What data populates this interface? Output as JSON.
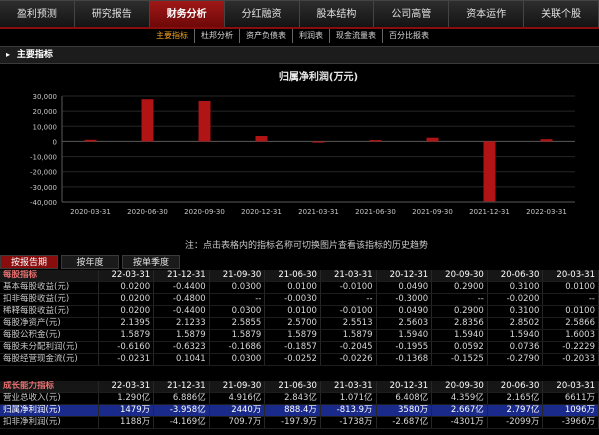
{
  "tabs": [
    {
      "label": "盈利预测",
      "active": false
    },
    {
      "label": "研究报告",
      "active": false
    },
    {
      "label": "财务分析",
      "active": true
    },
    {
      "label": "分红融资",
      "active": false
    },
    {
      "label": "股本结构",
      "active": false
    },
    {
      "label": "公司高管",
      "active": false
    },
    {
      "label": "资本运作",
      "active": false
    },
    {
      "label": "关联个股",
      "active": false
    }
  ],
  "subtabs": [
    {
      "label": "主要指标",
      "active": true
    },
    {
      "label": "杜邦分析",
      "active": false
    },
    {
      "label": "资产负债表",
      "active": false
    },
    {
      "label": "利润表",
      "active": false
    },
    {
      "label": "现金流量表",
      "active": false
    },
    {
      "label": "百分比报表",
      "active": false
    }
  ],
  "section": {
    "arrow": "▸",
    "title": "主要指标"
  },
  "note": "注：点击表格内的指标名称可切换图片查看该指标的历史趋势",
  "period_tabs": [
    {
      "label": "按报告期",
      "active": true
    },
    {
      "label": "按年度",
      "active": false
    },
    {
      "label": "按单季度",
      "active": false
    }
  ],
  "colors": {
    "accent": "#8a0d0d",
    "bar": "#b01414",
    "selected_row": "#1a2a8a",
    "active_subtab": "#f0a020"
  },
  "chart_data": {
    "type": "bar",
    "title": "归属净利润(万元)",
    "ylim": [
      -40000,
      30000
    ],
    "yticks": [
      30000,
      20000,
      10000,
      0,
      -10000,
      -20000,
      -30000,
      -40000
    ],
    "ytick_labels": [
      "30,000",
      "20,000",
      "10,000",
      "0",
      "-10,000",
      "-20,000",
      "-30,000",
      "-40,000"
    ],
    "x_tick_labels": [
      "2020-03-31",
      "2020-06-30",
      "2020-09-30",
      "2020-12-31",
      "2021-03-31",
      "2021-06-30",
      "2021-09-30",
      "2021-12-31",
      "2022-03-31"
    ],
    "categories": [
      "2020-03-31",
      "2020-06-30",
      "2020-09-30",
      "2020-12-31",
      "2021-03-31",
      "2021-06-30",
      "2021-09-30",
      "2021-12-31",
      "2022-03-31"
    ],
    "values": [
      1096,
      27900,
      26700,
      3580,
      -814,
      888,
      2440,
      -39580,
      1479
    ],
    "grid": true
  },
  "table1": {
    "headers": [
      "每股指标",
      "22-03-31",
      "21-12-31",
      "21-09-30",
      "21-06-30",
      "21-03-31",
      "20-12-31",
      "20-09-30",
      "20-06-30",
      "20-03-31"
    ],
    "rows": [
      {
        "label": "基本每股收益(元)",
        "values": [
          "0.0200",
          "-0.4400",
          "0.0300",
          "0.0100",
          "-0.0100",
          "0.0490",
          "0.2900",
          "0.3100",
          "0.0100"
        ]
      },
      {
        "label": "扣非每股收益(元)",
        "values": [
          "0.0200",
          "-0.4800",
          "--",
          "-0.0030",
          "--",
          "-0.3000",
          "--",
          "-0.0200",
          "--"
        ]
      },
      {
        "label": "稀释每股收益(元)",
        "values": [
          "0.0200",
          "-0.4400",
          "0.0300",
          "0.0100",
          "-0.0100",
          "0.0490",
          "0.2900",
          "0.3100",
          "0.0100"
        ]
      },
      {
        "label": "每股净资产(元)",
        "values": [
          "2.1395",
          "2.1233",
          "2.5855",
          "2.5700",
          "2.5513",
          "2.5603",
          "2.8356",
          "2.8502",
          "2.5866"
        ]
      },
      {
        "label": "每股公积金(元)",
        "values": [
          "1.5879",
          "1.5879",
          "1.5879",
          "1.5879",
          "1.5879",
          "1.5940",
          "1.5940",
          "1.5940",
          "1.6003"
        ]
      },
      {
        "label": "每股未分配利润(元)",
        "values": [
          "-0.6160",
          "-0.6323",
          "-0.1686",
          "-0.1857",
          "-0.2045",
          "-0.1955",
          "0.0592",
          "0.0736",
          "-0.2229"
        ]
      },
      {
        "label": "每股经营现金流(元)",
        "values": [
          "-0.0231",
          "0.1041",
          "0.0300",
          "-0.0252",
          "-0.0226",
          "-0.1368",
          "-0.1525",
          "-0.2790",
          "-0.2033"
        ]
      }
    ]
  },
  "table2": {
    "headers": [
      "成长能力指标",
      "22-03-31",
      "21-12-31",
      "21-09-30",
      "21-06-30",
      "21-03-31",
      "20-12-31",
      "20-09-30",
      "20-06-30",
      "20-03-31"
    ],
    "rows": [
      {
        "label": "营业总收入(元)",
        "selected": false,
        "values": [
          "1.290亿",
          "6.886亿",
          "4.916亿",
          "2.843亿",
          "1.071亿",
          "6.408亿",
          "4.359亿",
          "2.165亿",
          "6611万"
        ]
      },
      {
        "label": "归属净利润(元)",
        "selected": true,
        "values": [
          "1479万",
          "-3.958亿",
          "2440万",
          "888.4万",
          "-813.9万",
          "3580万",
          "2.667亿",
          "2.797亿",
          "1096万"
        ]
      },
      {
        "label": "扣非净利润(元)",
        "selected": false,
        "values": [
          "1188万",
          "-4.169亿",
          "709.7万",
          "-197.9万",
          "-1738万",
          "-2.687亿",
          "-4301万",
          "-2099万",
          "-3966万"
        ]
      }
    ]
  }
}
